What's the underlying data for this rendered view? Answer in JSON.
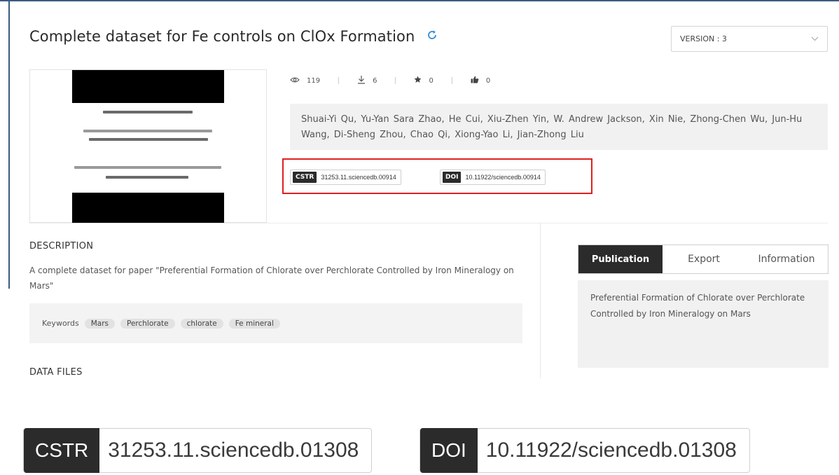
{
  "header": {
    "title": "Complete dataset for Fe controls on ClOx Formation",
    "version_label": "VERSION : 3"
  },
  "stats": {
    "views": "119",
    "downloads": "6",
    "stars": "0",
    "likes": "0"
  },
  "authors": "Shuai-Yi Qu,  Yu-Yan Sara Zhao,  He Cui,  Xiu-Zhen Yin,  W. Andrew Jackson,  Xin Nie,  Zhong-Chen Wu,  Jun-Hu Wang,  Di-Sheng Zhou,  Chao Qi,  Xiong-Yao Li,  Jian-Zhong Liu",
  "identifiers": {
    "cstr_tag": "CSTR",
    "cstr_value": "31253.11.sciencedb.00914",
    "doi_tag": "DOI",
    "doi_value": "10.11922/sciencedb.00914"
  },
  "description": {
    "heading": "DESCRIPTION",
    "text": "A complete dataset for paper \"Preferential Formation of Chlorate over Perchlorate Controlled by Iron Mineralogy on Mars\"",
    "keywords_label": "Keywords",
    "keywords": [
      "Mars",
      "Perchlorate",
      "chlorate",
      "Fe mineral"
    ]
  },
  "data_files_heading": "DATA FILES",
  "side_tabs": {
    "publication": "Publication",
    "export": "Export",
    "information": "Information"
  },
  "publication_text": "Preferential Formation of Chlorate over Perchlorate Controlled by Iron Mineralogy on Mars",
  "zoomed_identifiers": {
    "cstr_tag": "CSTR",
    "cstr_value": "31253.11.sciencedb.01308",
    "doi_tag": "DOI",
    "doi_value": "10.11922/sciencedb.01308"
  },
  "colors": {
    "frame_accent": "#3d5a80",
    "highlight_border": "#e02020",
    "tag_background": "#2b2b2b",
    "refresh_icon": "#2f8fd8"
  }
}
